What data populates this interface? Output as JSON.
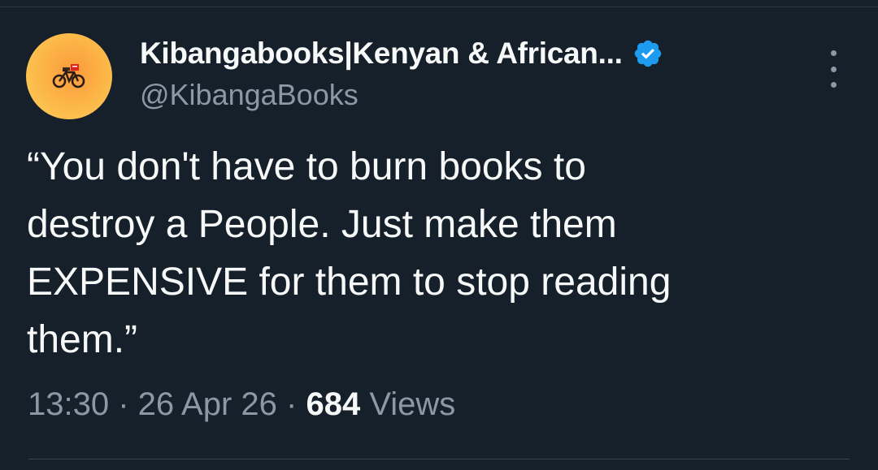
{
  "tweet": {
    "author": {
      "display_name": "Kibangabooks|Kenyan & African...",
      "handle": "@KibangaBooks",
      "verified": true,
      "avatar_icon": "bicycle-books-logo-icon"
    },
    "text": "“You don't have to burn books to\ndestroy a People. Just make them\nEXPENSIVE for them to stop reading\nthem.”",
    "meta": {
      "time": "13:30",
      "separator": " · ",
      "date": "26 Apr 26",
      "views_count": "684",
      "views_label": " Views"
    }
  },
  "colors": {
    "background": "#15202b",
    "primary_text": "#f7f9f9",
    "secondary_text": "#8b98a5",
    "verified_blue": "#1d9bf0",
    "avatar_orange": "#fcb94a"
  }
}
